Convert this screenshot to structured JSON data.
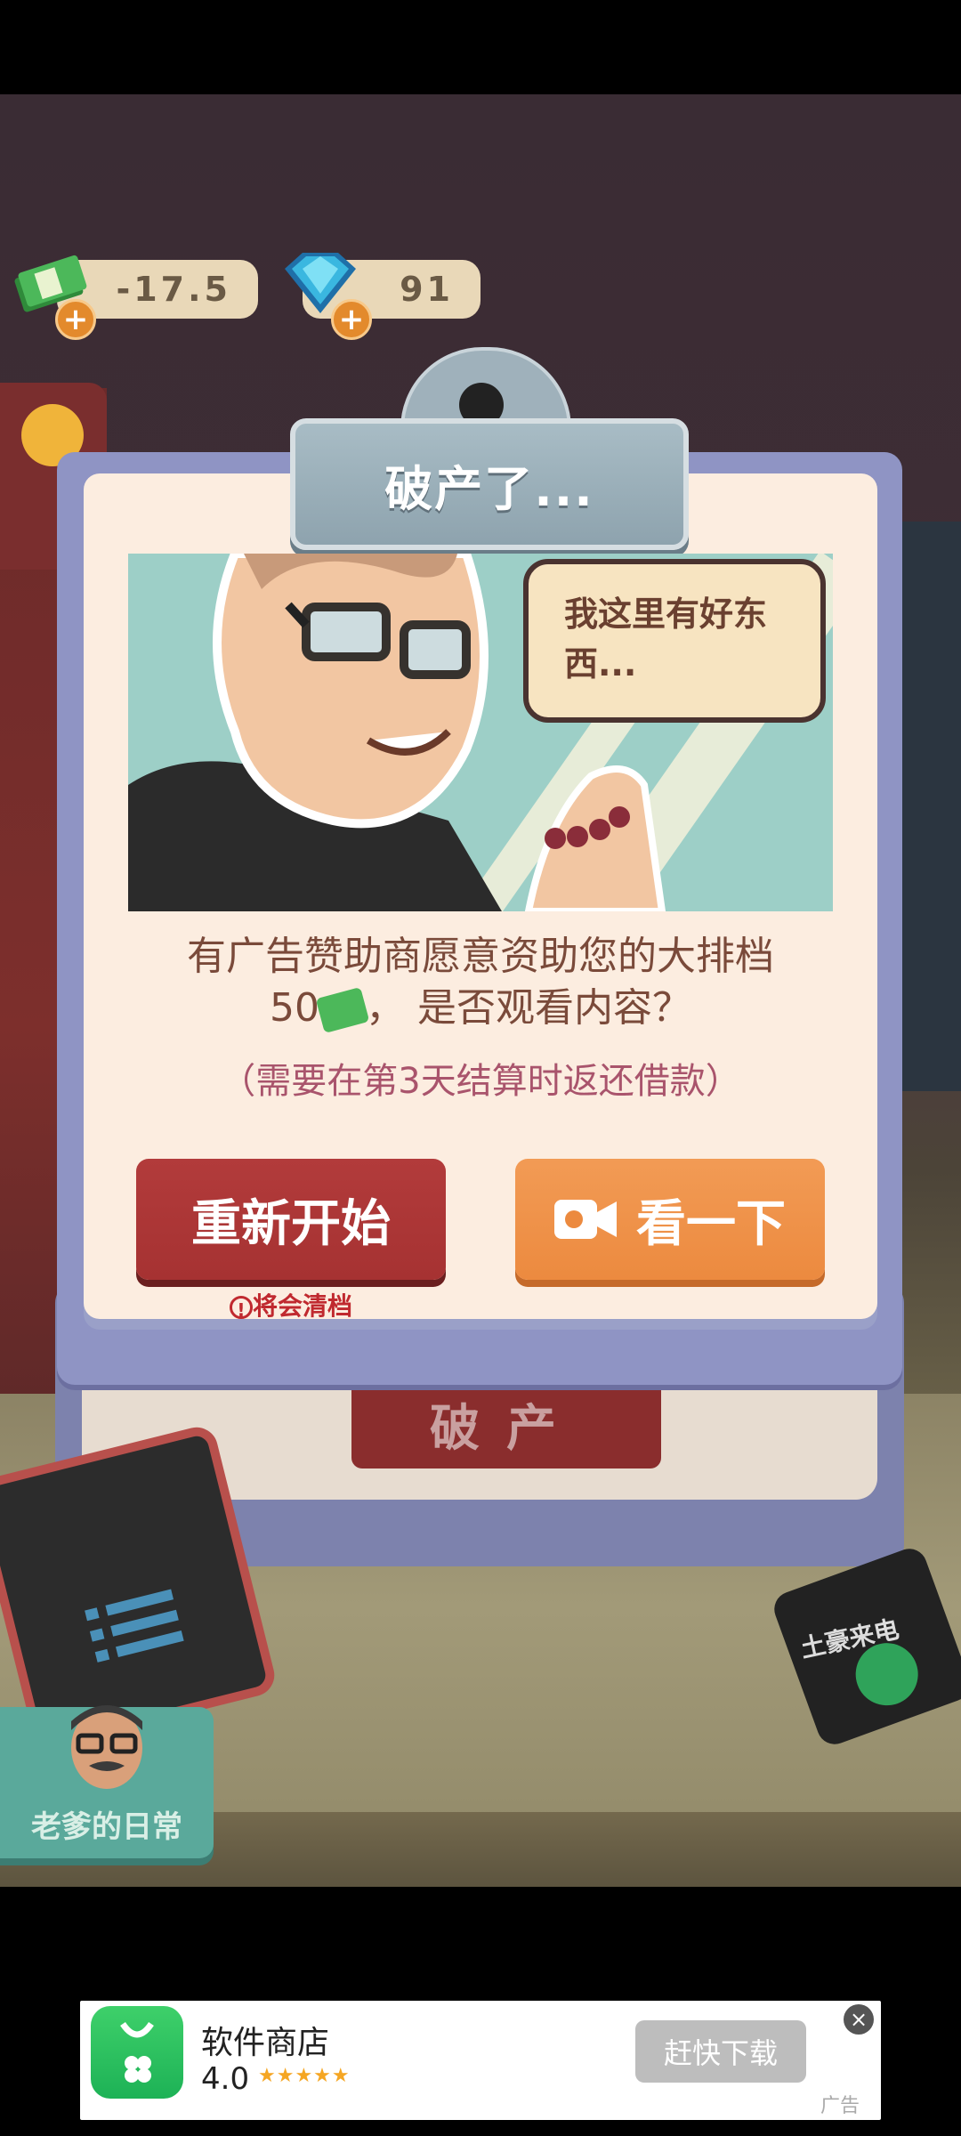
{
  "hud": {
    "money_value": "-17.5",
    "gems_value": "91"
  },
  "dialog": {
    "title": "破产了...",
    "speech_bubble": "我这里有好东西...",
    "message_line1": "有广告赞助商愿意资助您的大排档",
    "message_line2_amount": "50",
    "message_line2_rest": "，   是否观看内容？",
    "note": "（需要在第3天结算时返还借款）",
    "restart_label": "重新开始",
    "watch_label": "看一下",
    "warning": "将会清档"
  },
  "background": {
    "bankrupt_button": "破产",
    "dad_daily": "老爹的日常",
    "tycoon_call": "土豪来电"
  },
  "ad": {
    "app_name": "软件商店",
    "rating": "4.0",
    "stars": "★★★★★",
    "download_label": "赶快下载",
    "ad_label": "广告"
  }
}
